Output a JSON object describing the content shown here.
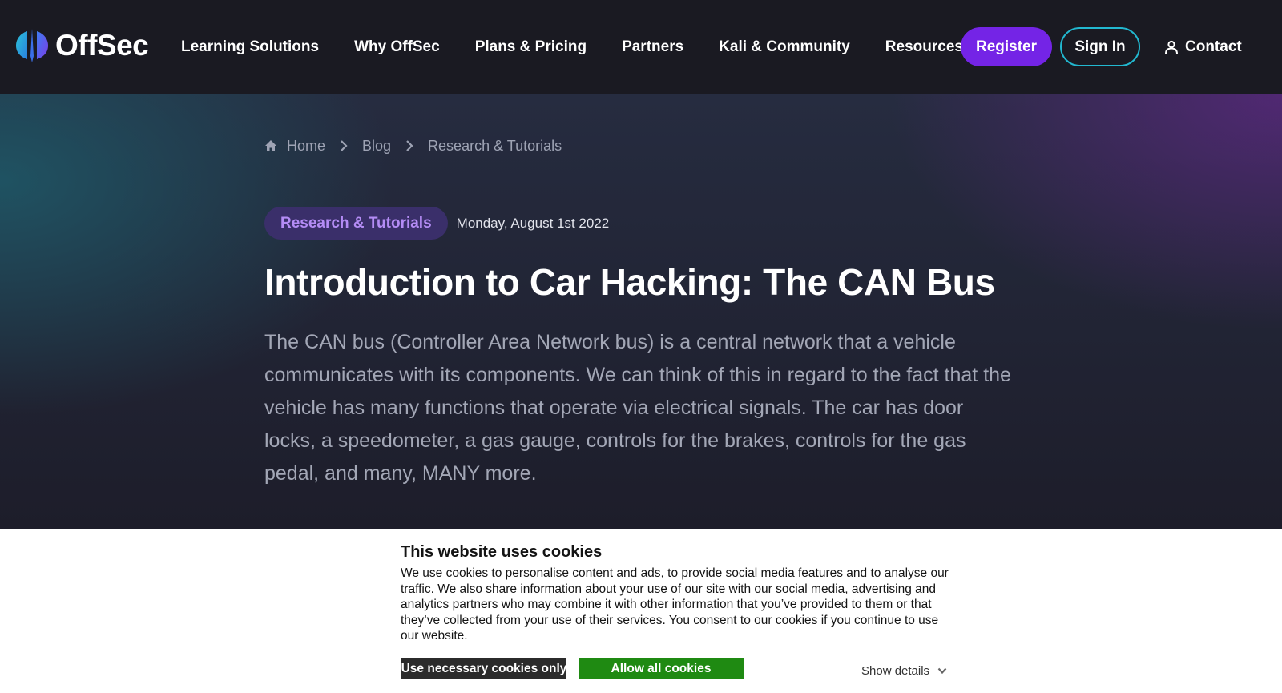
{
  "header": {
    "logo_text": "OffSec",
    "nav": [
      "Learning Solutions",
      "Why OffSec",
      "Plans & Pricing",
      "Partners",
      "Kali & Community",
      "Resources"
    ],
    "register_label": "Register",
    "signin_label": "Sign In",
    "contact_label": "Contact"
  },
  "breadcrumb": {
    "home": "Home",
    "blog": "Blog",
    "current": "Research & Tutorials"
  },
  "post": {
    "category": "Research & Tutorials",
    "date": "Monday, August 1st 2022",
    "title": "Introduction to Car Hacking: The CAN Bus",
    "intro": "The CAN bus (Controller Area Network bus) is a central network that a vehicle communicates with its components. We can think of this in regard to the fact that the vehicle has many functions that operate via electrical signals. The car has door locks, a speedometer, a gas gauge, controls for the brakes, controls for the gas pedal, and many, MANY more."
  },
  "cookie_banner": {
    "title": "This website uses cookies",
    "text": "We use cookies to personalise content and ads, to provide social media features and to analyse our traffic. We also share information about your use of our site with our social media, advertising and analytics partners who may combine it with other information that you’ve provided to them or that they’ve collected from your use of their services. You consent to our cookies if you continue to use our website.",
    "necessary_label": "Use necessary cookies only",
    "allow_label": "Allow all cookies",
    "details_label": "Show details"
  },
  "colors": {
    "header_bg": "#1a1a22",
    "brand_purple": "#7424e6",
    "signin_border": "#22b8d0",
    "category_text": "#b48cf5",
    "allow_green": "#1f8a12"
  },
  "icons": [
    "offsec-logo-icon",
    "user-icon",
    "home-icon",
    "chevron-right-icon",
    "chevron-down-icon"
  ]
}
